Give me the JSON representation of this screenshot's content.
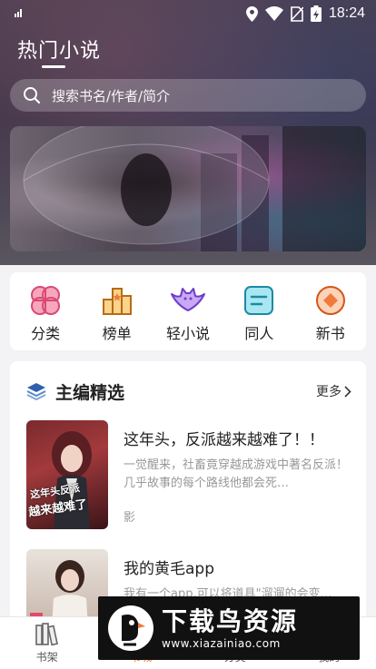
{
  "status_bar": {
    "time": "18:24"
  },
  "header": {
    "title": "热门小说",
    "search_placeholder": "搜索书名/作者/简介"
  },
  "categories": [
    {
      "label": "分类",
      "icon": "clover-icon",
      "color": "#f06c8f"
    },
    {
      "label": "榜单",
      "icon": "ranking-icon",
      "color": "#f3a53b"
    },
    {
      "label": "轻小说",
      "icon": "bat-icon",
      "color": "#9b6cf0"
    },
    {
      "label": "同人",
      "icon": "card-icon",
      "color": "#38c0d8"
    },
    {
      "label": "新书",
      "icon": "diamond-icon",
      "color": "#f07a3a"
    }
  ],
  "featured": {
    "title": "主编精选",
    "more_label": "更多",
    "books": [
      {
        "title": "这年头，反派越来越难了！！",
        "description": "一觉醒来，社畜竟穿越成游戏中著名反派！几乎故事的每个路线他都会死…",
        "author": "影",
        "cover_text_top": "这年头反派",
        "cover_text_bottom": "越来越难了"
      },
      {
        "title": "我的黄毛app",
        "description": "我有一个app,可以将道具\"溜遛的会变…",
        "author": ""
      }
    ]
  },
  "bottom_nav": [
    {
      "label": "书架",
      "icon": "bookshelf-icon",
      "active": false
    },
    {
      "label": "书城",
      "icon": "store-icon",
      "active": true
    },
    {
      "label": "分类",
      "icon": "category-icon",
      "active": false
    },
    {
      "label": "我的",
      "icon": "profile-icon",
      "active": false
    }
  ],
  "watermark": {
    "text": "下载鸟资源",
    "url": "www.xiazainiao.com"
  },
  "colors": {
    "accent": "#f07a3a"
  }
}
